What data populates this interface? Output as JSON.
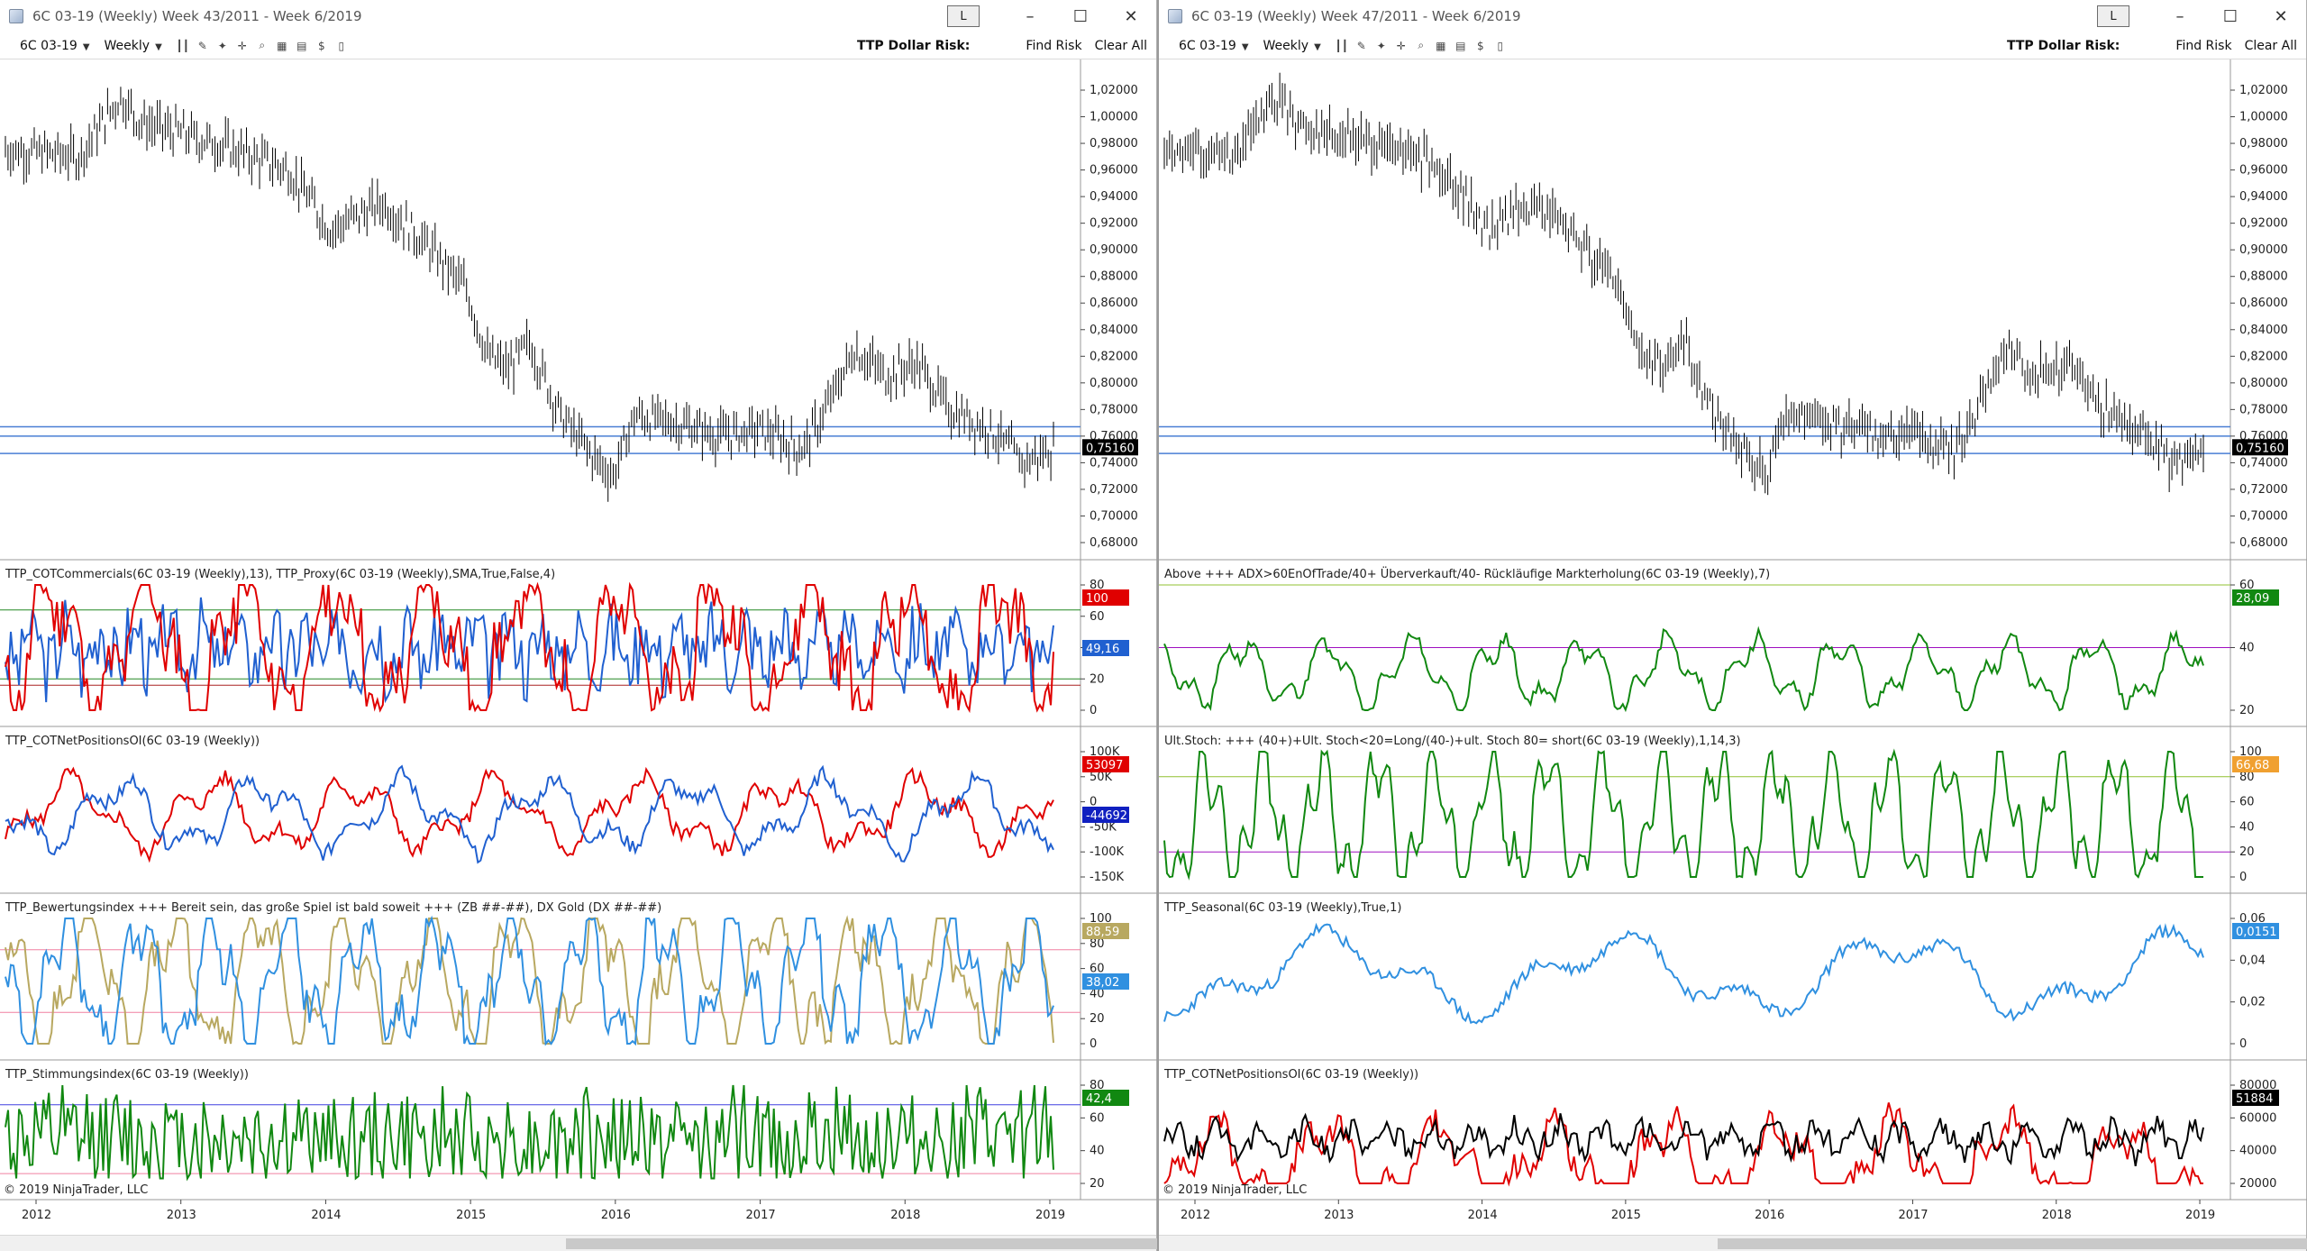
{
  "windows": [
    {
      "title": "6C 03-19 (Weekly)  Week 43/2011 - Week 6/2019",
      "lbtn": "L",
      "instrument": "6C 03-19",
      "interval": "Weekly",
      "risk_label": "TTP Dollar Risk:",
      "find_risk": "Find Risk",
      "clear_all": "Clear All",
      "price_ticks": [
        "1,02000",
        "1,00000",
        "0,98000",
        "0,96000",
        "0,94000",
        "0,92000",
        "0,90000",
        "0,88000",
        "0,86000",
        "0,84000",
        "0,82000",
        "0,80000",
        "0,78000",
        "0,76000",
        "0,74000",
        "0,72000",
        "0,70000",
        "0,68000"
      ],
      "price_tag": "0,75160",
      "panels": [
        {
          "label": "TTP_COTCommercials(6C 03-19 (Weekly),13), TTP_Proxy(6C 03-19 (Weekly),SMA,True,False,4)",
          "ticks": [
            "80",
            "60",
            "40",
            "20",
            "0"
          ],
          "tags": [
            {
              "text": "100",
              "color": "#e00000"
            },
            {
              "text": "49,16",
              "color": "#2060d0"
            }
          ]
        },
        {
          "label": "TTP_COTNetPositionsOI(6C 03-19 (Weekly))",
          "ticks": [
            "100K",
            "50K",
            "0",
            "-50K",
            "-100K",
            "-150K"
          ],
          "tags": [
            {
              "text": "53097",
              "color": "#e00000"
            },
            {
              "text": "-44692",
              "color": "#1020c0"
            }
          ]
        },
        {
          "label": "TTP_Bewertungsindex  +++ Bereit sein, das große Spiel ist bald soweit  +++ (ZB ##-##), DX Gold (DX ##-##)",
          "ticks": [
            "100",
            "80",
            "60",
            "40",
            "20",
            "0"
          ],
          "tags": [
            {
              "text": "88,59",
              "color": "#b8a860"
            },
            {
              "text": "38,02",
              "color": "#3090e0"
            }
          ]
        },
        {
          "label": "TTP_Stimmungsindex(6C 03-19 (Weekly))",
          "ticks": [
            "80",
            "60",
            "40",
            "20"
          ],
          "tags": [
            {
              "text": "42,4",
              "color": "#118811"
            }
          ]
        }
      ],
      "copyright": "© 2019 NinjaTrader, LLC",
      "years": [
        "2012",
        "2013",
        "2014",
        "2015",
        "2016",
        "2017",
        "2018",
        "2019"
      ]
    },
    {
      "title": "6C 03-19 (Weekly)  Week 47/2011 - Week 6/2019",
      "lbtn": "L",
      "instrument": "6C 03-19",
      "interval": "Weekly",
      "risk_label": "TTP Dollar Risk:",
      "find_risk": "Find Risk",
      "clear_all": "Clear All",
      "price_ticks": [
        "1,02000",
        "1,00000",
        "0,98000",
        "0,96000",
        "0,94000",
        "0,92000",
        "0,90000",
        "0,88000",
        "0,86000",
        "0,84000",
        "0,82000",
        "0,80000",
        "0,78000",
        "0,76000",
        "0,74000",
        "0,72000",
        "0,70000",
        "0,68000"
      ],
      "price_tag": "0,75160",
      "panels": [
        {
          "label": "Above +++ ADX>60EnOfTrade/40+ Überverkauft/40- Rückläufige Markterholung(6C 03-19 (Weekly),7)",
          "ticks": [
            "60",
            "40",
            "20"
          ],
          "tags": [
            {
              "text": "28,09",
              "color": "#118811"
            }
          ]
        },
        {
          "label": "Ult.Stoch: +++ (40+)+Ult. Stoch<20=Long/(40-)+ult. Stoch 80= short(6C 03-19 (Weekly),1,14,3)",
          "ticks": [
            "100",
            "80",
            "60",
            "40",
            "20",
            "0"
          ],
          "tags": [
            {
              "text": "66,68",
              "color": "#f0a030"
            }
          ]
        },
        {
          "label": "TTP_Seasonal(6C 03-19 (Weekly),True,1)",
          "ticks": [
            "0,06",
            "0,04",
            "0,02",
            "0"
          ],
          "tags": [
            {
              "text": "0,0151",
              "color": "#3090e0"
            }
          ]
        },
        {
          "label": "TTP_COTNetPositionsOI(6C 03-19 (Weekly))",
          "ticks": [
            "80000",
            "60000",
            "40000",
            "20000"
          ],
          "tags": [
            {
              "text": "51884",
              "color": "#000000"
            }
          ]
        }
      ],
      "copyright": "© 2019 NinjaTrader, LLC",
      "years": [
        "2012",
        "2013",
        "2014",
        "2015",
        "2016",
        "2017",
        "2018",
        "2019"
      ]
    }
  ],
  "colors": {
    "price_bars": "#000000",
    "hline_blue": "#4a7fd4",
    "green": "#118811",
    "red": "#e00000",
    "blue": "#2060d0",
    "lightblue": "#3090e0",
    "khaki": "#b8a860",
    "pink": "#f080a0",
    "purple": "#a010c0",
    "lime": "#90c030"
  },
  "icons": [
    "bars-icon",
    "pencil-icon",
    "magic-wand-icon",
    "crosshair-icon",
    "zoom-icon",
    "templates-icon",
    "properties-icon",
    "dollar-icon",
    "panel-icon"
  ],
  "window_buttons": {
    "minimize": "–",
    "maximize": "☐",
    "close": "✕"
  }
}
